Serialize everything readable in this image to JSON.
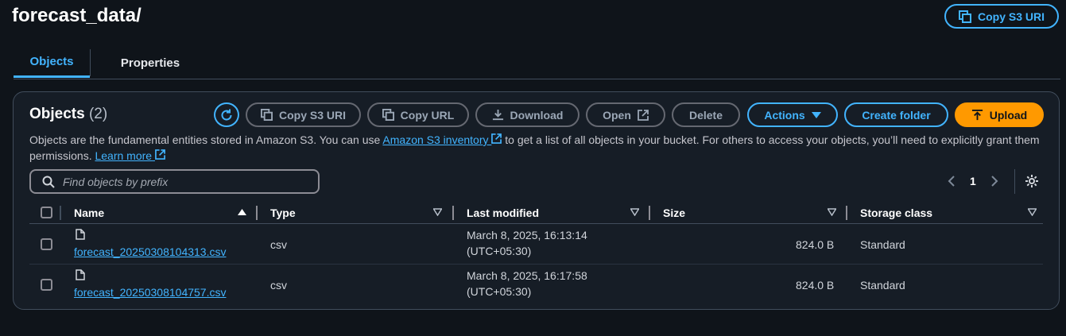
{
  "header": {
    "title": "forecast_data/",
    "copy_s3_uri_label": "Copy S3 URI"
  },
  "tabs": [
    {
      "label": "Objects",
      "active": true
    },
    {
      "label": "Properties",
      "active": false
    }
  ],
  "objects_panel": {
    "title": "Objects",
    "count": "(2)",
    "toolbar": {
      "copy_s3_uri": "Copy S3 URI",
      "copy_url": "Copy URL",
      "download": "Download",
      "open": "Open",
      "delete": "Delete",
      "actions": "Actions",
      "create_folder": "Create folder",
      "upload": "Upload"
    },
    "description": {
      "part1": "Objects are the fundamental entities stored in Amazon S3. You can use ",
      "inventory_link": "Amazon S3 inventory",
      "part2": " to get a list of all objects in your bucket. For others to access your objects, you’ll need to explicitly grant them permissions. ",
      "learn_more": "Learn more"
    },
    "search_placeholder": "Find objects by prefix",
    "pagination": {
      "current_page": "1"
    },
    "columns": [
      "Name",
      "Type",
      "Last modified",
      "Size",
      "Storage class"
    ],
    "rows": [
      {
        "name": "forecast_20250308104313.csv",
        "type": "csv",
        "modified_line1": "March 8, 2025, 16:13:14",
        "modified_line2": "(UTC+05:30)",
        "size": "824.0 B",
        "storage_class": "Standard"
      },
      {
        "name": "forecast_20250308104757.csv",
        "type": "csv",
        "modified_line1": "March 8, 2025, 16:17:58",
        "modified_line2": "(UTC+05:30)",
        "size": "824.0 B",
        "storage_class": "Standard"
      }
    ]
  },
  "colors": {
    "background": "#0f141a",
    "panel": "#161d26",
    "accent_blue": "#42b4ff",
    "primary_orange": "#ff9900",
    "border": "#414d5c"
  }
}
